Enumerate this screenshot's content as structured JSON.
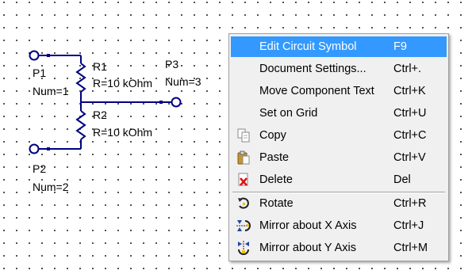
{
  "schematic": {
    "components": [
      {
        "id": "P1",
        "ref": "P1",
        "param": "Num=1"
      },
      {
        "id": "P2",
        "ref": "P2",
        "param": "Num=2"
      },
      {
        "id": "P3",
        "ref": "P3",
        "param": "Num=3"
      },
      {
        "id": "R1",
        "ref": "R1",
        "param": "R=10 kOhm"
      },
      {
        "id": "R2",
        "ref": "R2",
        "param": "R=10 kOhm"
      }
    ],
    "wire_color": "#000080",
    "terminal_color": "#000080",
    "grid_dot_color": "#000000"
  },
  "context_menu": {
    "items": [
      {
        "label": "Edit Circuit Symbol",
        "shortcut": "F9",
        "icon": "",
        "highlighted": true
      },
      {
        "label": "Document Settings...",
        "shortcut": "Ctrl+.",
        "icon": ""
      },
      {
        "label": "Move Component Text",
        "shortcut": "Ctrl+K",
        "icon": ""
      },
      {
        "label": "Set on Grid",
        "shortcut": "Ctrl+U",
        "icon": ""
      },
      {
        "label": "Copy",
        "shortcut": "Ctrl+C",
        "icon": "copy-icon"
      },
      {
        "label": "Paste",
        "shortcut": "Ctrl+V",
        "icon": "paste-icon"
      },
      {
        "label": "Delete",
        "shortcut": "Del",
        "icon": "delete-icon"
      },
      {
        "label": "Rotate",
        "shortcut": "Ctrl+R",
        "icon": "rotate-icon"
      },
      {
        "label": "Mirror about X Axis",
        "shortcut": "Ctrl+J",
        "icon": "mirror-x-icon"
      },
      {
        "label": "Mirror about Y Axis",
        "shortcut": "Ctrl+M",
        "icon": "mirror-y-icon"
      }
    ],
    "highlight_color": "#3399ff"
  }
}
